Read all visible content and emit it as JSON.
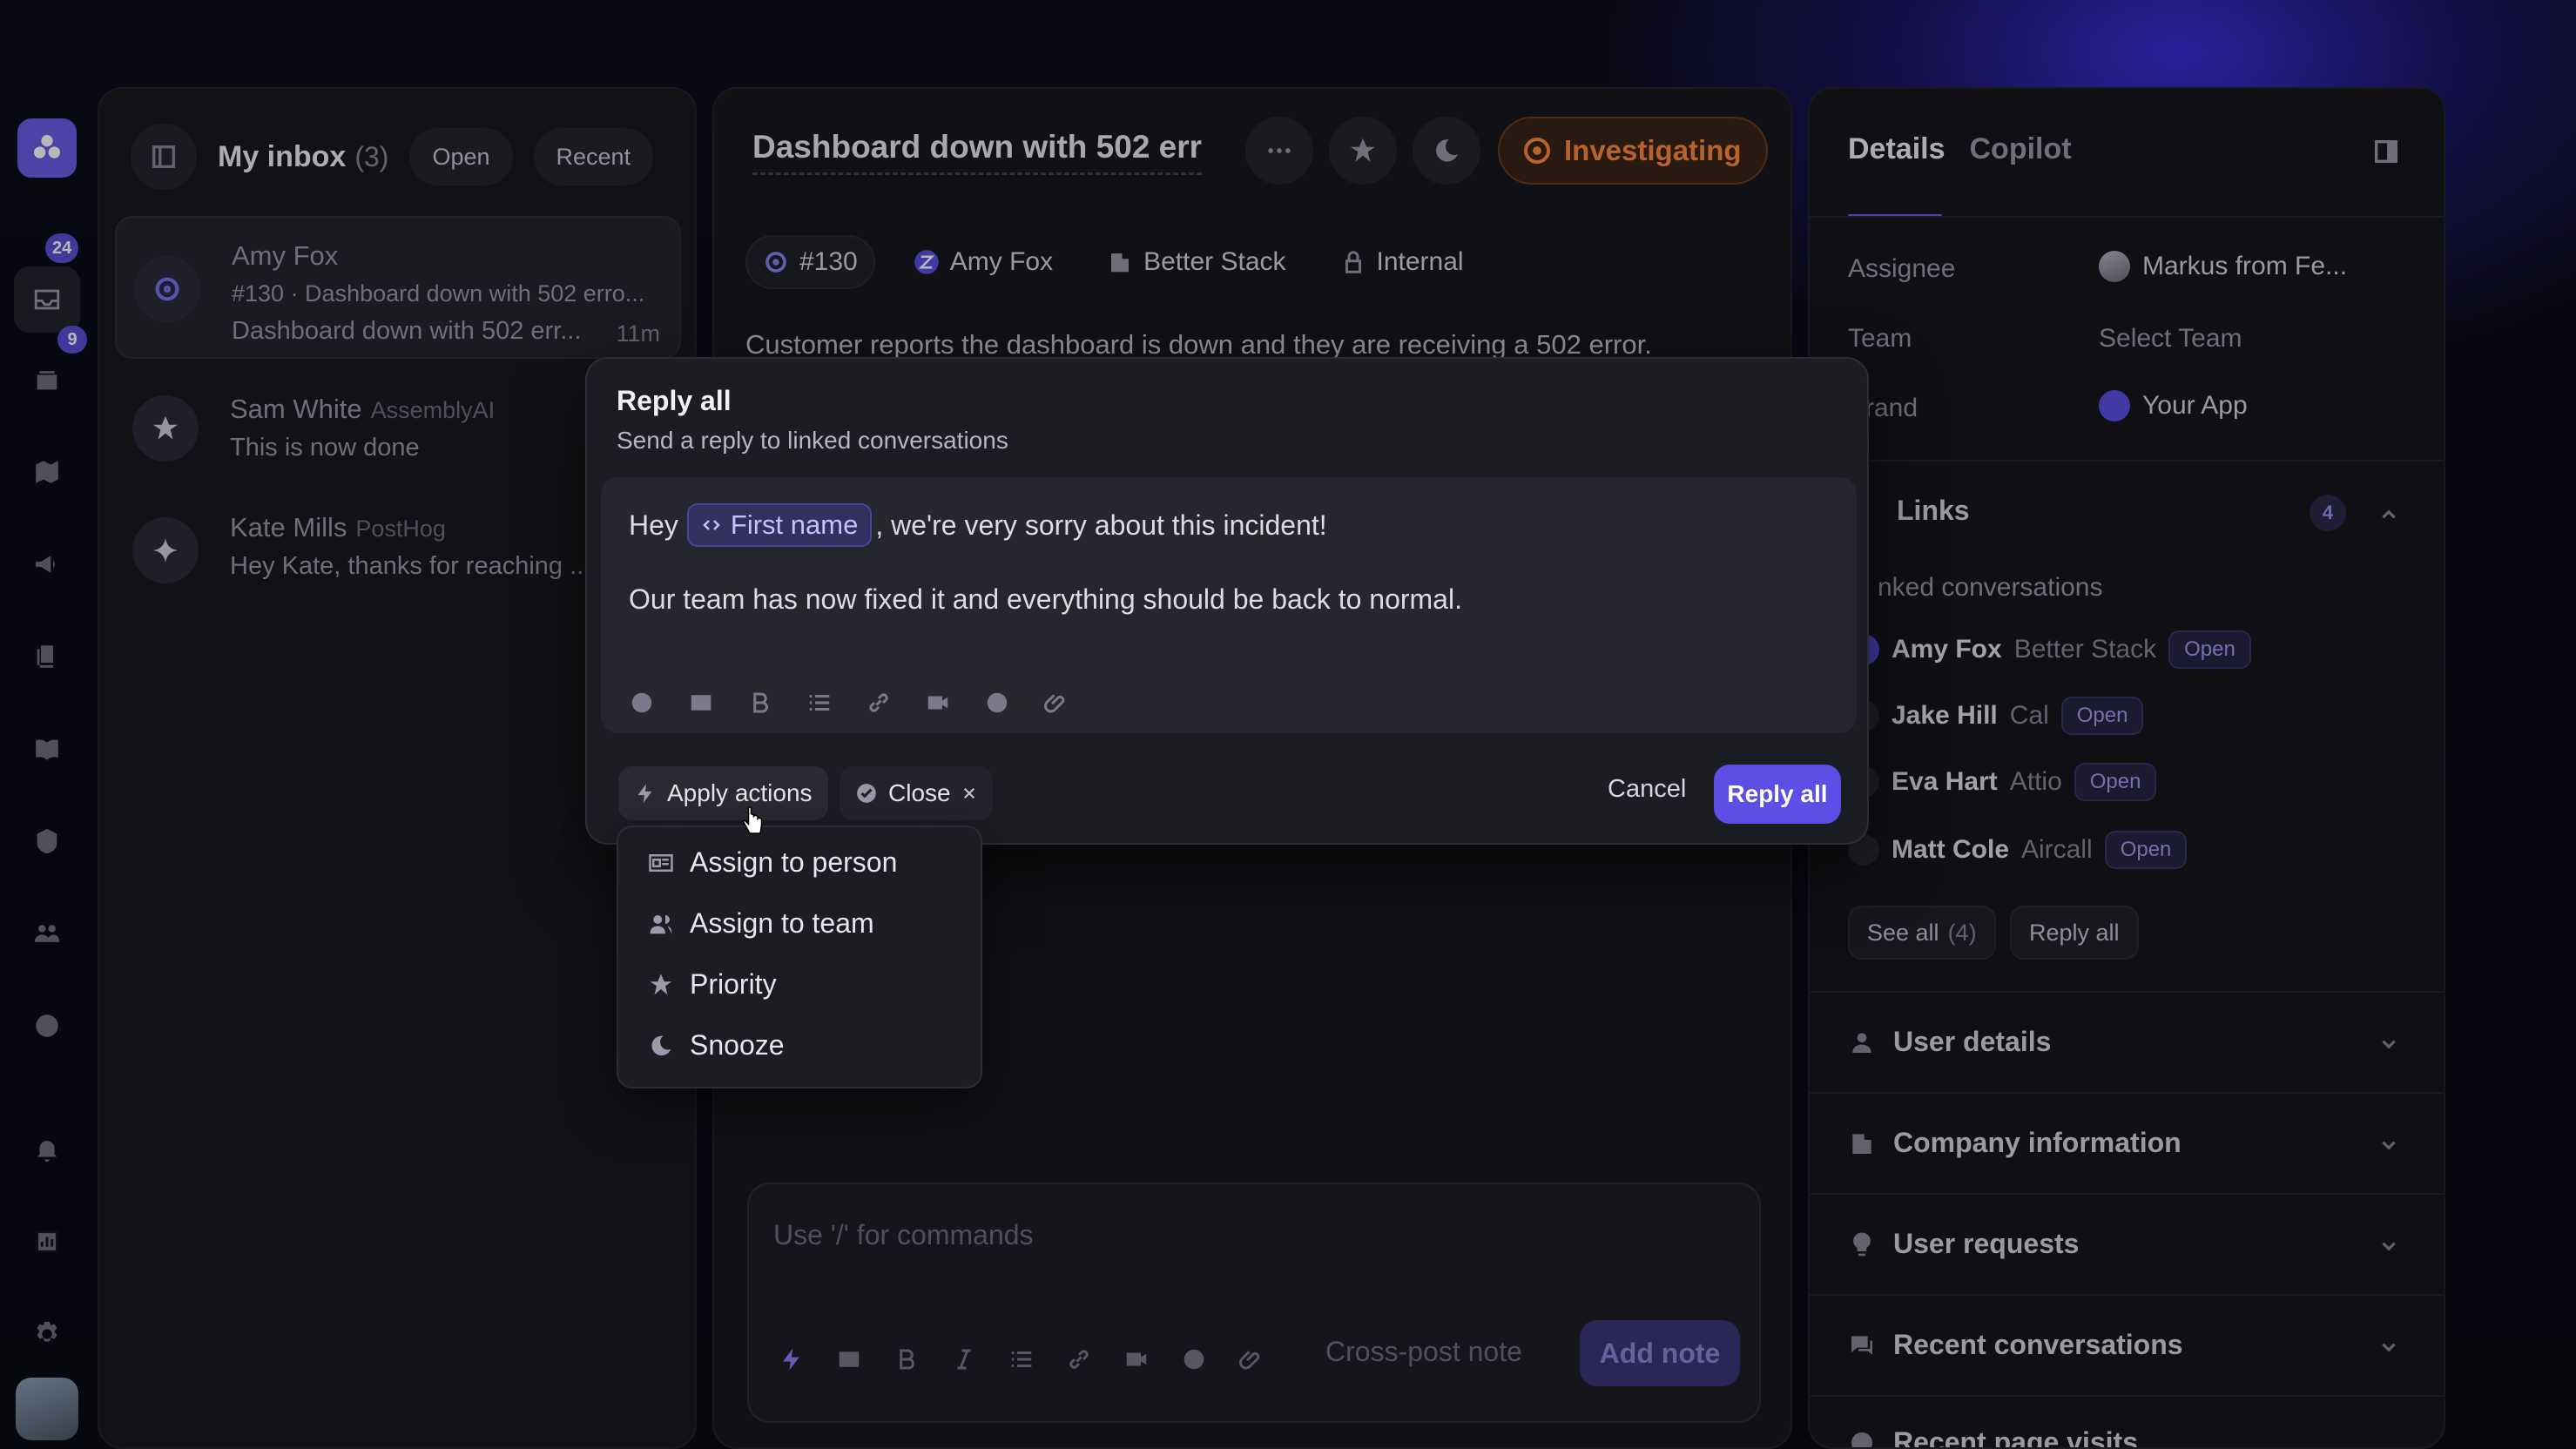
{
  "rail": {
    "badges": {
      "inbox": "24",
      "queue": "9"
    }
  },
  "inbox": {
    "title": "My inbox",
    "count": "(3)",
    "filter_open": "Open",
    "filter_recent": "Recent",
    "conversations": [
      {
        "name": "Amy Fox",
        "org": "",
        "line1": "#130 · Dashboard down with 502 erro...",
        "line2": "Dashboard down with 502 err...",
        "time": "11m"
      },
      {
        "name": "Sam White",
        "org": "AssemblyAI",
        "line1": "This is now done",
        "line2": "",
        "time": ""
      },
      {
        "name": "Kate Mills",
        "org": "PostHog",
        "line1": "Hey Kate, thanks for reaching ...",
        "line2": "",
        "time": ""
      }
    ]
  },
  "conversation": {
    "title": "Dashboard down with 502 err",
    "status": "Investigating",
    "ticket": "#130",
    "customer": "Amy Fox",
    "company": "Better Stack",
    "visibility": "Internal",
    "body": "Customer reports the dashboard is down and they are receiving a 502 error.",
    "composer_placeholder": "Use '/' for commands",
    "cross_post": "Cross-post note",
    "add_note": "Add note"
  },
  "details": {
    "tab_details": "Details",
    "tab_copilot": "Copilot",
    "assignee_label": "Assignee",
    "assignee_value": "Markus from Fe...",
    "team_label": "Team",
    "team_value": "Select Team",
    "brand_label": "rand",
    "brand_value": "Your App",
    "links_title": "Links",
    "links_count": "4",
    "linked_label": "nked conversations",
    "linked": [
      {
        "name": "Amy Fox",
        "org": "Better Stack",
        "status": "Open"
      },
      {
        "name": "Jake Hill",
        "org": "Cal",
        "status": "Open"
      },
      {
        "name": "Eva Hart",
        "org": "Attio",
        "status": "Open"
      },
      {
        "name": "Matt Cole",
        "org": "Aircall",
        "status": "Open"
      }
    ],
    "see_all": "See all",
    "see_all_count": "(4)",
    "reply_all": "Reply all",
    "sections": [
      "User details",
      "Company information",
      "User requests",
      "Recent conversations",
      "Recent page visits"
    ]
  },
  "modal": {
    "title": "Reply all",
    "subtitle": "Send a reply to linked conversations",
    "line1_prefix": "Hey",
    "variable": "First name",
    "line1_suffix": ", we're very sorry about this incident!",
    "line2": "Our team has now fixed it and everything should be back to normal.",
    "apply_actions": "Apply actions",
    "close_action": "Close",
    "cancel": "Cancel",
    "submit": "Reply all"
  },
  "actions_menu": [
    "Assign to person",
    "Assign to team",
    "Priority",
    "Snooze"
  ],
  "colors": {
    "accent": "#5b4fe6",
    "status_orange": "#ff8a3d",
    "panel": "#18181e"
  }
}
